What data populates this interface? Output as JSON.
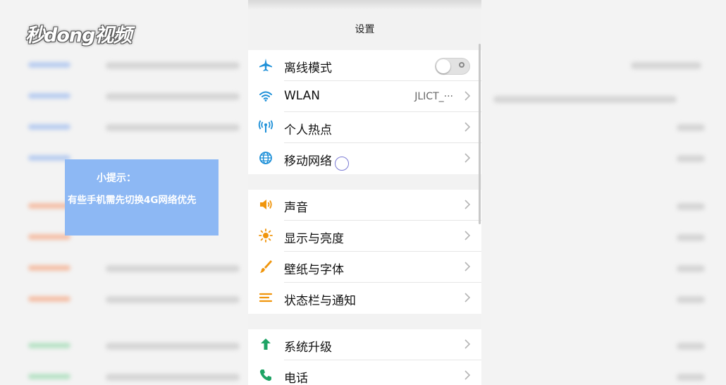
{
  "watermark": "秒dong视频",
  "tip": {
    "title": "小提示：",
    "body": "有些手机需先切换4G网络优先"
  },
  "settings": {
    "title": "设置",
    "group1": [
      {
        "label": "离线模式",
        "icon": "airplane-icon",
        "type": "toggle",
        "toggle_on": false
      },
      {
        "label": "WLAN",
        "icon": "wifi-icon",
        "value": "JLICT_···"
      },
      {
        "label": "个人热点",
        "icon": "hotspot-icon"
      },
      {
        "label": "移动网络",
        "icon": "globe-icon"
      }
    ],
    "group2": [
      {
        "label": "声音",
        "icon": "speaker-icon"
      },
      {
        "label": "显示与亮度",
        "icon": "sun-icon"
      },
      {
        "label": "壁纸与字体",
        "icon": "brush-icon"
      },
      {
        "label": "状态栏与通知",
        "icon": "menu-lines-icon"
      }
    ],
    "group3": [
      {
        "label": "系统升级",
        "icon": "up-arrow-icon"
      },
      {
        "label": "电话",
        "icon": "phone-icon"
      }
    ]
  },
  "colors": {
    "accent_blue": "#1e90d8",
    "accent_orange": "#f0950c",
    "accent_green": "#1ea365",
    "tip_bg": "#8db8f4"
  }
}
